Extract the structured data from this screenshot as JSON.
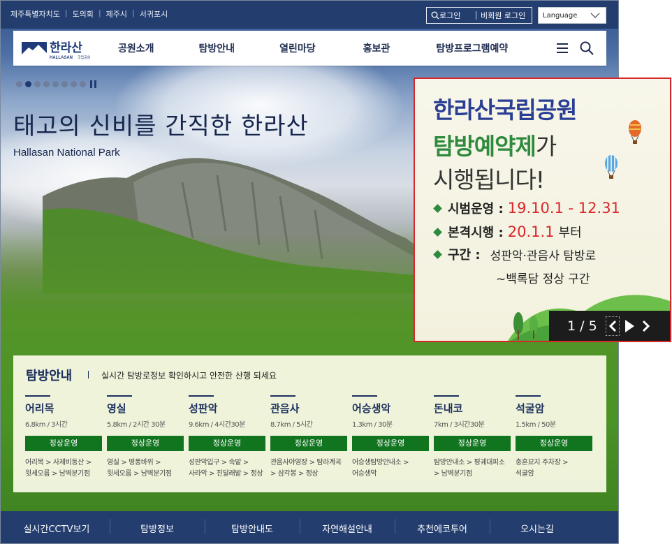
{
  "util": {
    "links": [
      "제주특별자치도",
      "도의회",
      "제주시",
      "서귀포시"
    ],
    "login": "로그인",
    "guest_login": "비회원 로그인",
    "language": "Language"
  },
  "nav": {
    "logo_kr": "한라산",
    "logo_en": "HALLASAN",
    "logo_sub": "국립공원",
    "menu": [
      "공원소개",
      "탐방안내",
      "열린마당",
      "홍보관",
      "탐방프로그램예약"
    ]
  },
  "hero": {
    "title": "태고의 신비를 간직한 한라산",
    "subtitle": "Hallasan National Park",
    "dots_total": 8,
    "dot_active": 2
  },
  "popup": {
    "line1": "한라산국립공원",
    "line2": "탐방예약제",
    "line2_suffix": "가",
    "line3": "시행됩니다!",
    "b1_label": "시범운영 :",
    "b1_value": "19.10.1 - 12.31",
    "b2_label": "본격시행 :",
    "b2_value": "20.1.1",
    "b2_suffix": "부터",
    "b3_label": "구간 :",
    "b3_value": "성판악·관음사 탐방로",
    "b3_value2": "~백록담 정상 구간",
    "counter": "1 / 5"
  },
  "hike": {
    "title": "탐방안내",
    "desc": "실시간 탐방로정보 확인하시고 안전한 산행 되세요",
    "trails": [
      {
        "name": "어리목",
        "dist": "6.8km / 3시간",
        "status": "정상운영",
        "route1": "어리목 > 사제비동산 >",
        "route2": "윗세오름 > 남벽분기점"
      },
      {
        "name": "영실",
        "dist": "5.8km / 2시간 30분",
        "status": "정상운영",
        "route1": "영실 > 병풍바위 >",
        "route2": "윗세오름 > 남벽분기점"
      },
      {
        "name": "성판악",
        "dist": "9.6km / 4시간30분",
        "status": "정상운영",
        "route1": "성판악입구 > 속밭 >",
        "route2": "사라악 > 진달래밭 > 정상"
      },
      {
        "name": "관음사",
        "dist": "8.7km / 5시간",
        "status": "정상운영",
        "route1": "관음사야영장 > 탐라계곡",
        "route2": "> 삼각봉 > 정상"
      },
      {
        "name": "어승생악",
        "dist": "1.3km / 30분",
        "status": "정상운영",
        "route1": "어승생탐방안내소 >",
        "route2": "어승생악"
      },
      {
        "name": "돈내코",
        "dist": "7km / 3시간30분",
        "status": "정상운영",
        "route1": "탐방안내소 > 평궤대피소",
        "route2": "> 남벽분기점"
      },
      {
        "name": "석굴암",
        "dist": "1.5km / 50분",
        "status": "정상운영",
        "route1": "충혼묘지 주차장 >",
        "route2": "석굴암"
      }
    ]
  },
  "bottom": [
    "실시간CCTV보기",
    "탐방정보",
    "탐방안내도",
    "자연해설안내",
    "추천에코투어",
    "오시는길"
  ],
  "colors": {
    "navy": "#233d6e",
    "status_green": "#11741f",
    "popup_border": "#d8272b",
    "popup_blue": "#2a3f94",
    "popup_green": "#2e8a3d"
  }
}
